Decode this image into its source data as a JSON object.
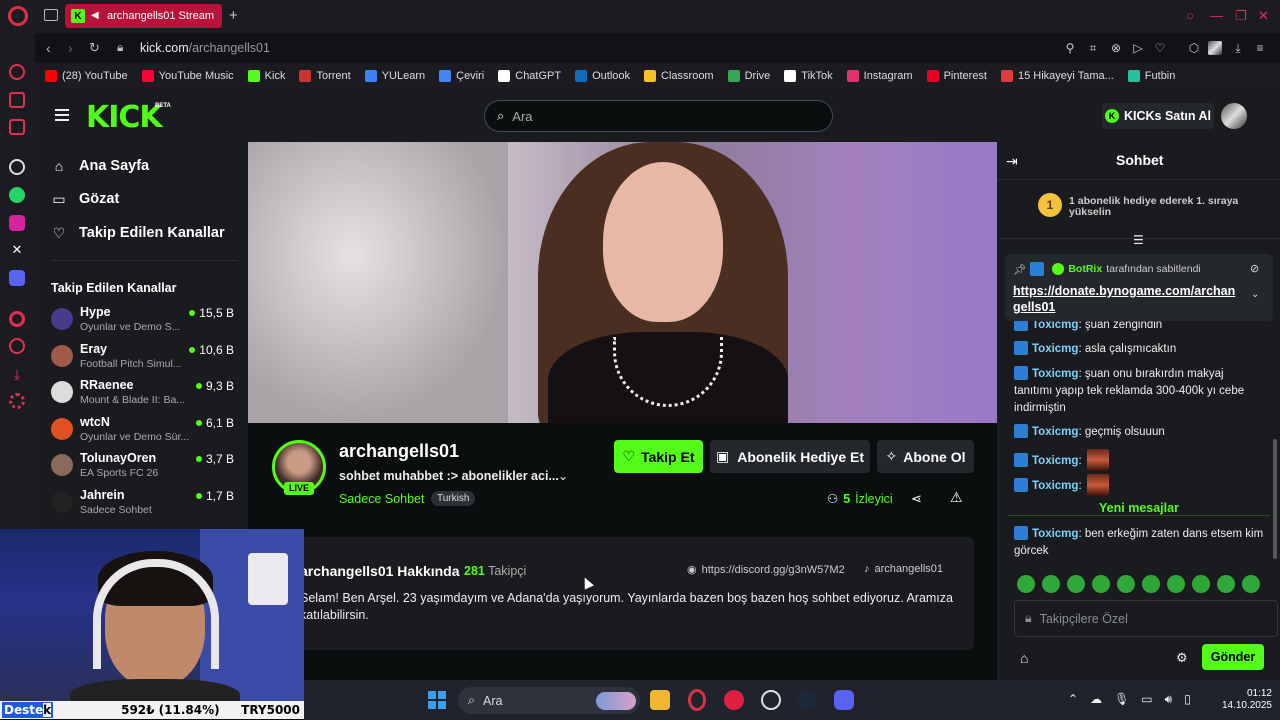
{
  "browser": {
    "tab_title": "archangells01 Stream",
    "url_host": "kick.com",
    "url_path": "/archangells01",
    "bookmarks": [
      {
        "label": "(28) YouTube",
        "icon": "youtube-icon",
        "color": "#ff0000"
      },
      {
        "label": "YouTube Music",
        "icon": "youtube-music-icon",
        "color": "#ff0033"
      },
      {
        "label": "Kick",
        "icon": "kick-icon",
        "color": "#53fc18"
      },
      {
        "label": "Torrent",
        "icon": "torrent-icon",
        "color": "#c33"
      },
      {
        "label": "YULearn",
        "icon": "yulearn-icon",
        "color": "#3b82f6"
      },
      {
        "label": "Çeviri",
        "icon": "translate-icon",
        "color": "#4285f4"
      },
      {
        "label": "ChatGPT",
        "icon": "chatgpt-icon",
        "color": "#ffffff"
      },
      {
        "label": "Outlook",
        "icon": "outlook-icon",
        "color": "#0f6cbd"
      },
      {
        "label": "Classroom",
        "icon": "classroom-icon",
        "color": "#f7c325"
      },
      {
        "label": "Drive",
        "icon": "drive-icon",
        "color": "#34a853"
      },
      {
        "label": "TikTok",
        "icon": "tiktok-icon",
        "color": "#ffffff"
      },
      {
        "label": "Instagram",
        "icon": "instagram-icon",
        "color": "#e1306c"
      },
      {
        "label": "Pinterest",
        "icon": "pinterest-icon",
        "color": "#e60023"
      },
      {
        "label": "15 Hikayeyi Tama...",
        "icon": "bookmark-icon",
        "color": "#e03a3a"
      },
      {
        "label": "Futbin",
        "icon": "futbin-icon",
        "color": "#25c2a0"
      }
    ]
  },
  "kick": {
    "search_placeholder": "Ara",
    "kicks_button": "KICKs Satın Al",
    "nav": {
      "home": "Ana Sayfa",
      "browse": "Gözat",
      "following": "Takip Edilen Kanallar"
    },
    "followed_section_title": "Takip Edilen Kanallar",
    "followed_channels": [
      {
        "name": "Hype",
        "game": "Oyunlar ve Demo S...",
        "viewers": "15,5 B",
        "avatar_color": "#4a3a8a"
      },
      {
        "name": "Eray",
        "game": "Football Pitch Simul...",
        "viewers": "10,6 B",
        "avatar_color": "#a05a4a"
      },
      {
        "name": "RRaenee",
        "game": "Mount & Blade II: Ba...",
        "viewers": "9,3 B",
        "avatar_color": "#dddddd"
      },
      {
        "name": "wtcN",
        "game": "Oyunlar ve Demo Sür...",
        "viewers": "6,1 B",
        "avatar_color": "#e05020"
      },
      {
        "name": "TolunayOren",
        "game": "EA Sports FC 26",
        "viewers": "3,7 B",
        "avatar_color": "#8a6a5a"
      },
      {
        "name": "Jahrein",
        "game": "Sadece Sohbet",
        "viewers": "1,7 B",
        "avatar_color": "#222222"
      }
    ],
    "stream": {
      "channel": "archangells01",
      "title": "sohbet muhabbet :> abonelikler aci...",
      "category": "Sadece Sohbet",
      "language": "Turkish",
      "live_label": "LIVE",
      "follow_label": "Takip Et",
      "gift_label": "Abonelik Hediye Et",
      "subscribe_label": "Abone Ol",
      "viewer_count": "5",
      "viewer_label": "İzleyici"
    },
    "about": {
      "title": "archangells01 Hakkında",
      "followers": "281",
      "followers_label": "Takipçi",
      "discord": "https://discord.gg/g3nW57M2",
      "tiktok": "archangells01",
      "bio": "Selam! Ben Arşel. 23 yaşımdayım ve Adana'da yaşıyorum. Yayınlarda bazen boş bazen hoş sohbet ediyoruz. Aramıza katılabilirsin."
    },
    "chat": {
      "title": "Sohbet",
      "gift_rank": "1",
      "gift_prompt": "1 abonelik hediye ederek 1. sıraya yükselin",
      "pinned_by": "BotRix",
      "pinned_suffix": "tarafından sabitlendi",
      "pinned_link": "https://donate.bynogame.com/archangells01",
      "messages": [
        {
          "user": "Toxicmg",
          "text": "şuan zengindin"
        },
        {
          "user": "Toxicmg",
          "text": "asla çalışmıcaktın"
        },
        {
          "user": "Toxicmg",
          "text": "şuan onu bırakırdın makyaj tanıtımı yapıp tek reklamda 300-400k yı cebe indirmiştin"
        },
        {
          "user": "Toxicmg",
          "text": "geçmiş olsuuun"
        },
        {
          "user": "Toxicmg",
          "text": ""
        },
        {
          "user": "Toxicmg",
          "text": ""
        }
      ],
      "new_messages_label": "Yeni mesajlar",
      "new_messages": [
        {
          "user": "Toxicmg",
          "text": "ben erkeğim zaten dans etsem kim görcek"
        }
      ],
      "input_placeholder": "Takipçilere Özel",
      "send_label": "Gönder"
    }
  },
  "overlay": {
    "donate_label_a": "Deste",
    "donate_label_b": "k",
    "donate_amount": "592₺ (11.84%)",
    "donate_goal": "TRY5000"
  },
  "taskbar": {
    "search_placeholder": "Ara",
    "time": "01:12",
    "date": "14.10.2025"
  }
}
